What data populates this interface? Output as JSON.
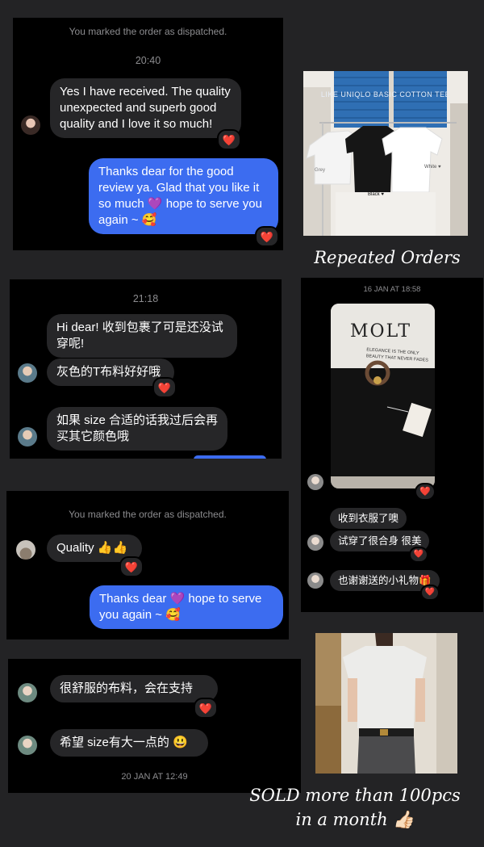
{
  "panel1": {
    "system_notice": "You marked the order as dispatched.",
    "time": "20:40",
    "incoming_lines": [
      "Yes I have received. The quality",
      "unexpected and superb good",
      "quality and I love it so much!"
    ],
    "reaction": "❤️",
    "outgoing_lines": [
      "Thanks dear for the good",
      "review ya. Glad that you like it",
      "so much 💜 hope to serve you",
      "again ~ 🥰"
    ],
    "outgoing_reaction": "❤️"
  },
  "panel2": {
    "time": "21:18",
    "msg1_lines": [
      "Hi dear! 收到包裹了可是还没试",
      "穿呢!"
    ],
    "msg2": "灰色的T布料好好哦",
    "msg2_reaction": "❤️",
    "msg3_lines": [
      "如果 size 合适的话我过后会再",
      "买其它颜色哦"
    ]
  },
  "panel3": {
    "system_notice": "You marked the order as dispatched.",
    "msg1": "Quality 👍👍",
    "msg1_reaction": "❤️",
    "outgoing_lines": [
      "Thanks dear 💜 hope to serve",
      "you again ~ 🥰"
    ]
  },
  "panel4": {
    "msg1": "很舒服的布料，会在支持",
    "msg1_reaction": "❤️",
    "msg2": "希望 size有大一点的 😃",
    "timestamp": "20 JAN AT 12:49"
  },
  "panel5": {
    "timestamp": "16 JAN AT 18:58",
    "photo_reaction": "❤️",
    "msg1": "收到衣服了噢",
    "msg2": "试穿了很合身 很美",
    "msg2_reaction": "❤️",
    "msg3": "也谢谢送的小礼物🎁",
    "msg3_reaction": "❤️"
  },
  "product_photo": {
    "overlay_text": "LIKE UNIQLO BASIC COTTON TEE",
    "label_black": "Black ♥",
    "label_white": "White ♥",
    "label_grey": "Grey"
  },
  "packaging_photo": {
    "brand": "MOLT",
    "slogan_lines": [
      "ELEGANCE IS THE ONLY",
      "BEAUTY THAT NEVER FADES"
    ]
  },
  "captions": {
    "repeated": "Repeated Orders",
    "sold_line1": "SOLD more than 100pcs",
    "sold_line2": "in a month 👍🏻"
  },
  "colors": {
    "background": "#232325",
    "incoming_bubble": "#262628",
    "outgoing_bubble": "#3c6cf0",
    "heart": "#ff2d3c",
    "meta_text": "#8c8c8f"
  }
}
